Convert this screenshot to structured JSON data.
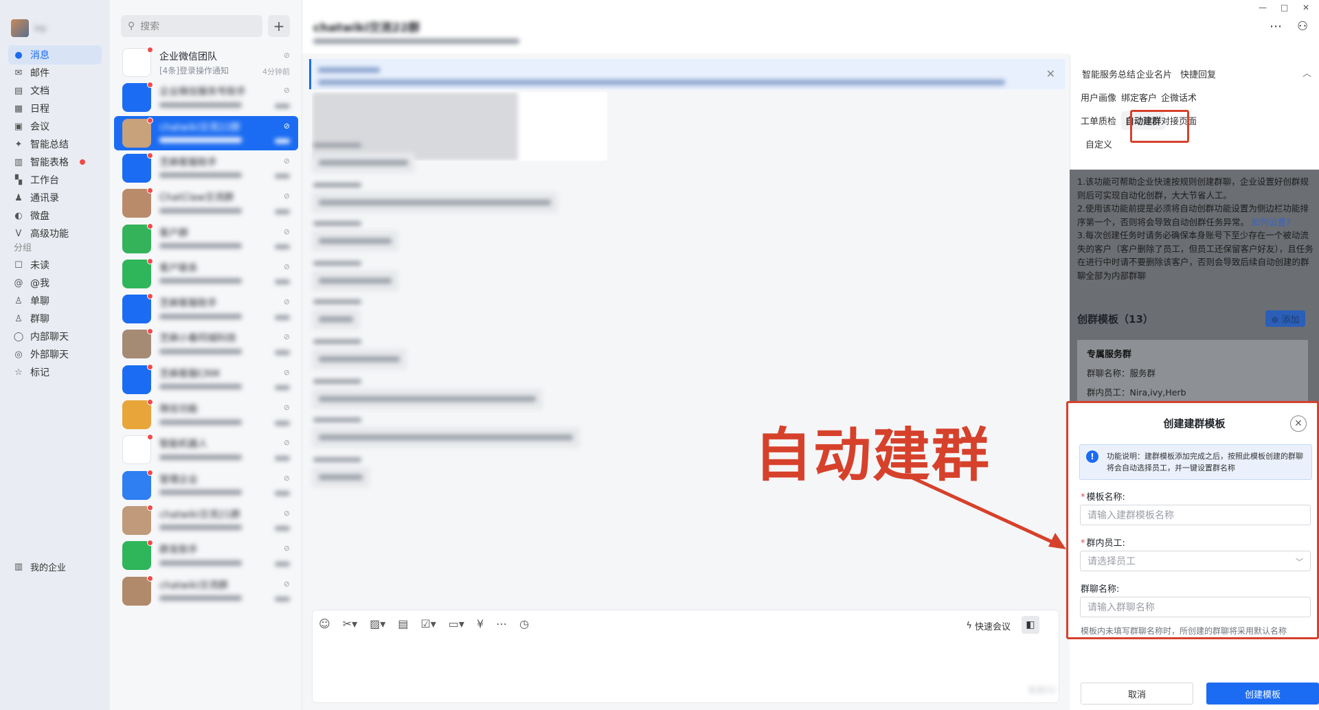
{
  "window": {
    "minimize": "—",
    "maximize": "□",
    "close": "✕"
  },
  "user": {
    "name": "ivy"
  },
  "nav": {
    "items": [
      {
        "label": "消息",
        "icon": "chat-bubble-icon",
        "active": true
      },
      {
        "label": "邮件",
        "icon": "mail-icon"
      },
      {
        "label": "文档",
        "icon": "document-icon"
      },
      {
        "label": "日程",
        "icon": "calendar-icon"
      },
      {
        "label": "会议",
        "icon": "meeting-icon"
      },
      {
        "label": "智能总结",
        "icon": "sparkle-icon"
      },
      {
        "label": "智能表格",
        "icon": "table-icon",
        "badge": true
      },
      {
        "label": "工作台",
        "icon": "grid-icon"
      },
      {
        "label": "通讯录",
        "icon": "contacts-icon"
      },
      {
        "label": "微盘",
        "icon": "disk-icon"
      },
      {
        "label": "高级功能",
        "icon": "advanced-icon"
      }
    ],
    "group_label": "分组",
    "groups": [
      {
        "label": "未读",
        "icon": "unread-icon"
      },
      {
        "label": "@我",
        "icon": "at-icon"
      },
      {
        "label": "单聊",
        "icon": "person-icon"
      },
      {
        "label": "群聊",
        "icon": "group-icon"
      },
      {
        "label": "内部聊天",
        "icon": "internal-chat-icon"
      },
      {
        "label": "外部聊天",
        "icon": "external-chat-icon"
      },
      {
        "label": "标记",
        "icon": "star-icon"
      }
    ],
    "footer": "我的企业"
  },
  "list": {
    "search_placeholder": "搜索",
    "add": "+",
    "conversations": [
      {
        "title": "企业微信团队",
        "sub": "[4条]登录操作通知",
        "time": "4分钟前",
        "color": "#ffffff",
        "blurred": false
      },
      {
        "title": "企业微信服务号助手",
        "color": "#1b6cf2",
        "blurred": true
      },
      {
        "title": "chatwiki交流22群",
        "color": "#c8a27a",
        "blurred": true,
        "active": true
      },
      {
        "title": "芝麻客服助手",
        "color": "#1b6cf2",
        "blurred": true
      },
      {
        "title": "ChatClaw交流群",
        "color": "#b98b6b",
        "blurred": true
      },
      {
        "title": "客户群",
        "color": "#34b35b",
        "blurred": true
      },
      {
        "title": "客户联系",
        "color": "#2fb55a",
        "blurred": true
      },
      {
        "title": "芝麻客服助手",
        "color": "#1b6cf2",
        "blurred": true
      },
      {
        "title": "芝麻小春同城科技",
        "color": "#a58a74",
        "blurred": true
      },
      {
        "title": "芝麻客服CRM",
        "color": "#1b6cf2",
        "blurred": true
      },
      {
        "title": "微信功能",
        "color": "#e8a53a",
        "blurred": true
      },
      {
        "title": "智能机器人",
        "color": "#ffffff",
        "blurred": true
      },
      {
        "title": "管理企业",
        "color": "#2f7ef2",
        "blurred": true
      },
      {
        "title": "chatwiki交流21群",
        "color": "#c09a7a",
        "blurred": true
      },
      {
        "title": "群发助手",
        "color": "#2fb55a",
        "blurred": true
      },
      {
        "title": "chatwiki交流群",
        "color": "#b08a6a",
        "blurred": true
      }
    ]
  },
  "chat": {
    "title": "chatwiki交流22群",
    "toolbar_icons": [
      "emoji-icon",
      "scissors-icon",
      "image-icon",
      "file-text-icon",
      "checkbox-icon",
      "folder-icon",
      "money-icon",
      "more-icon",
      "clock-icon"
    ],
    "quick_meeting": "快速会议",
    "send": "发送(S)"
  },
  "side": {
    "tabs": [
      "智能服务总结",
      "企业名片",
      "快捷回复",
      "用户画像",
      "绑定客户",
      "企微话术",
      "工单质检",
      "自动建群",
      "对接页面",
      "自定义"
    ],
    "active_tab": "自动建群",
    "collapse": "︿",
    "description": [
      "1.该功能可帮助企业快速按规则创建群聊，企业设置好创群规则后可实现自动化创群，大大节省人工。",
      "2.使用该功能前提是必须将自动创群功能设置为侧边栏功能排序第一个，否则将会导致自动创群任务异常。",
      "如何设置?",
      "3.每次创建任务时请务必确保本身账号下至少存在一个被动流失的客户（客户删除了员工，但员工还保留客户好友），且任务在进行中时请不要删除该客户，否则会导致后续自动创建的群聊全部为内部群聊"
    ],
    "templates_title": "创群模板（13）",
    "add_button": "⊕ 添加",
    "template": {
      "name": "专属服务群",
      "group_name": "群聊名称：服务群",
      "members": "群内员工：Nira,ivy,Herb"
    }
  },
  "dialog": {
    "title": "创建建群模板",
    "close": "✕",
    "info": "功能说明：建群模板添加完成之后，按照此模板创建的群聊将会自动选择员工，并一键设置群名称",
    "fields": [
      {
        "label": "模板名称:",
        "required": true,
        "placeholder": "请输入建群模板名称"
      },
      {
        "label": "群内员工:",
        "required": true,
        "placeholder": "请选择员工",
        "select": true
      },
      {
        "label": "群聊名称:",
        "required": false,
        "placeholder": "请输入群聊名称"
      }
    ],
    "hint": "模板内未填写群聊名称时，所创建的群聊将采用默认名称",
    "cancel": "取消",
    "create": "创建模板"
  },
  "annotation": {
    "text": "自动建群",
    "color": "#d6412b"
  }
}
